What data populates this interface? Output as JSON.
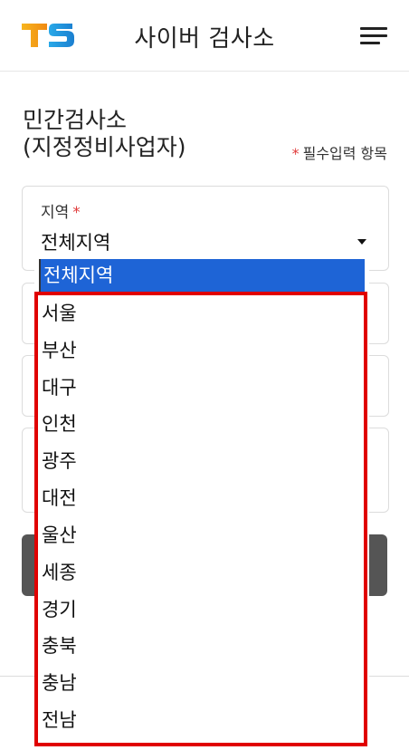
{
  "header": {
    "logo_text": "TS",
    "title": "사이버 검사소",
    "menu_icon": "hamburger-menu-icon"
  },
  "page": {
    "title_line1": "민간검사소",
    "title_line2": "(지정정비사업자)",
    "required_star": "*",
    "required_note": "필수입력 항목"
  },
  "region_field": {
    "label": "지역",
    "required_star": "*",
    "value": "전체지역"
  },
  "dropdown": {
    "selected": "전체지역",
    "options": [
      "서울",
      "부산",
      "대구",
      "인천",
      "광주",
      "대전",
      "울산",
      "세종",
      "경기",
      "충북",
      "충남",
      "전남"
    ]
  },
  "colors": {
    "accent_blue": "#1e64d6",
    "required_red": "#e03a3a",
    "highlight_red": "#e00000",
    "button_gray": "#555555",
    "logo_orange": "#f5a21b",
    "logo_blue": "#1b8fd8"
  }
}
